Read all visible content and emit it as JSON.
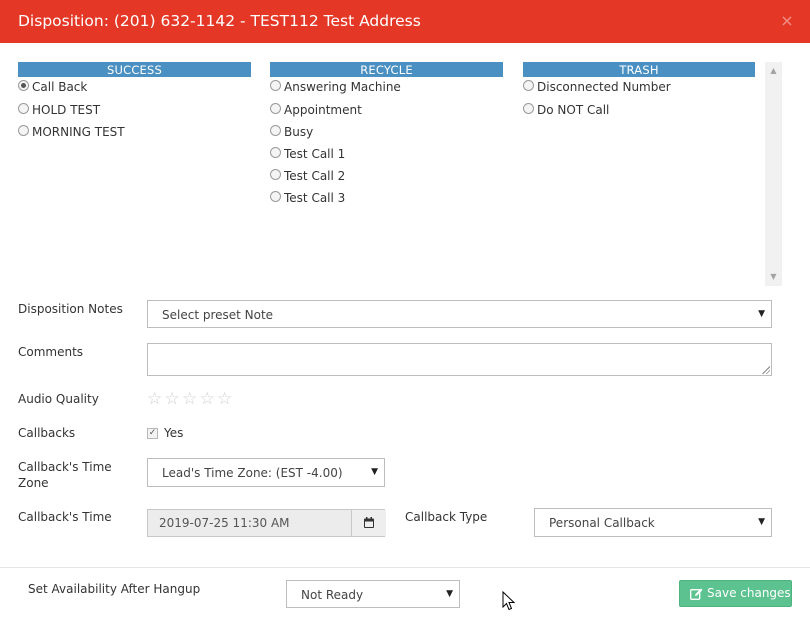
{
  "modal": {
    "title": "Disposition: (201) 632-1142 - TEST112 Test Address",
    "close_symbol": "×"
  },
  "columns": [
    {
      "header": "SUCCESS",
      "options": [
        {
          "label": "Call Back",
          "checked": true
        },
        {
          "label": "HOLD TEST",
          "checked": false
        },
        {
          "label": "MORNING TEST",
          "checked": false
        }
      ]
    },
    {
      "header": "RECYCLE",
      "options": [
        {
          "label": "Answering Machine",
          "checked": false
        },
        {
          "label": "Appointment",
          "checked": false
        },
        {
          "label": "Busy",
          "checked": false
        },
        {
          "label": "Test Call 1",
          "checked": false
        },
        {
          "label": "Test Call 2",
          "checked": false
        },
        {
          "label": "Test Call 3",
          "checked": false
        }
      ]
    },
    {
      "header": "TRASH",
      "options": [
        {
          "label": "Disconnected Number",
          "checked": false
        },
        {
          "label": "Do NOT Call",
          "checked": false
        }
      ]
    }
  ],
  "form": {
    "notes_label": "Disposition Notes",
    "notes_value": "Select preset Note",
    "comments_label": "Comments",
    "comments_value": "",
    "audio_quality_label": "Audio Quality",
    "audio_quality_rating": 0,
    "audio_quality_max": 5,
    "callbacks_label": "Callbacks",
    "callbacks_checkbox_label": "Yes",
    "callbacks_checked": true,
    "timezone_label_line1": "Callback's Time",
    "timezone_label_line2": "Zone",
    "timezone_value": "Lead's Time Zone: (EST -4.00)",
    "time_label": "Callback's Time",
    "time_value": "2019-07-25 11:30 AM",
    "type_label": "Callback Type",
    "type_value": "Personal Callback"
  },
  "footer": {
    "availability_label": "Set Availability After Hangup",
    "availability_value": "Not Ready",
    "save_label": "Save changes"
  },
  "colors": {
    "header_bg": "#e43725",
    "column_header_bg": "#4a90c2",
    "save_button_bg": "#5cc290"
  },
  "icons": {
    "close": "close-icon",
    "dropdown": "chevron-down-icon",
    "calendar": "calendar-icon",
    "edit": "edit-icon",
    "star": "star-icon",
    "cursor": "mouse-cursor-icon"
  }
}
